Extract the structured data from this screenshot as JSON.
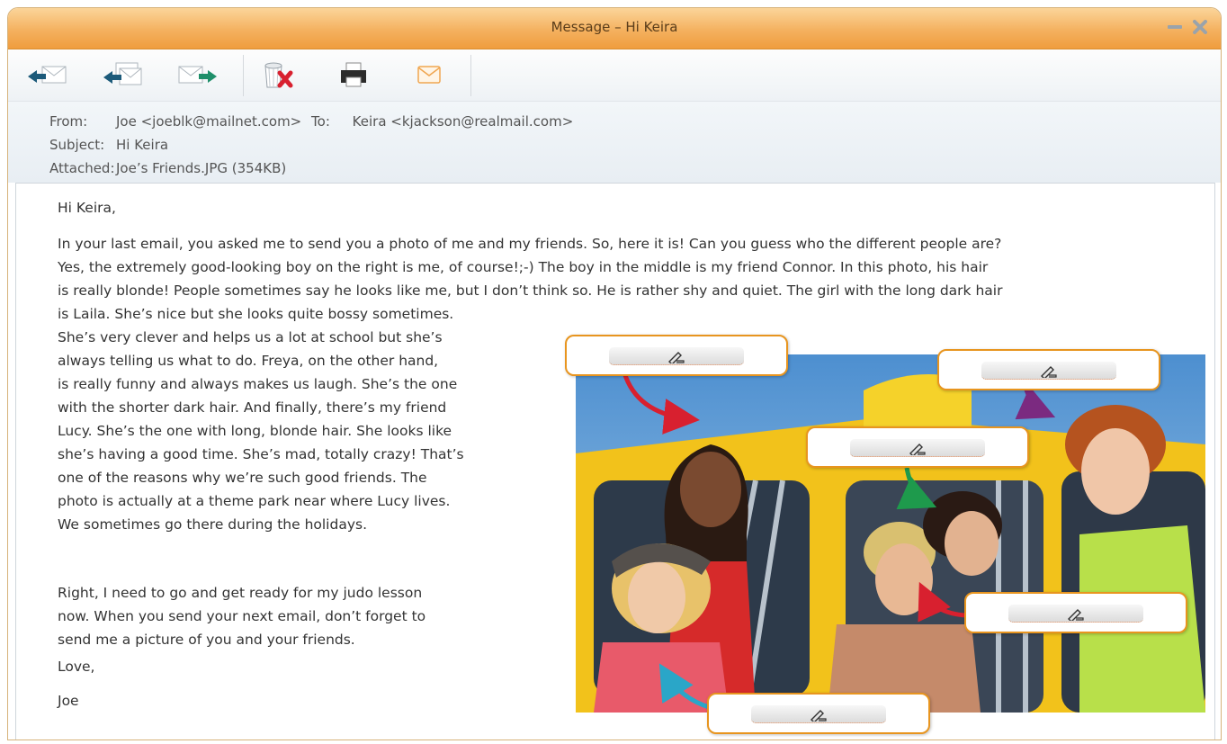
{
  "window": {
    "title": "Message – Hi Keira"
  },
  "toolbar": {
    "icons": [
      "reply-icon",
      "reply-all-icon",
      "forward-icon",
      "delete-icon",
      "print-icon",
      "new-mail-icon"
    ]
  },
  "headers": {
    "from_label": "From:",
    "from_value": "Joe <joeblk@mailnet.com>",
    "to_label": "To:",
    "to_value": "Keira <kjackson@realmail.com>",
    "subject_label": "Subject:",
    "subject_value": "Hi Keira",
    "attached_label": "Attached:",
    "attached_value": "Joe’s Friends.JPG (354KB)"
  },
  "message": {
    "greeting": "Hi Keira,",
    "full_lines": [
      "In your last email, you asked me to send you a photo of me and my friends. So, here it is! Can you guess who the different people are?",
      "Yes, the extremely good-looking boy on the right is me, of course!;-) The boy in the middle is my friend Connor. In this photo, his hair",
      "is really blonde! People sometimes say he looks like me, but I don’t think so. He is rather shy and quiet. The girl with the long dark hair"
    ],
    "wrapped_lines": [
      "is Laila. She’s nice but she looks quite bossy sometimes.",
      "She’s very clever and helps us a lot at school but she’s",
      "always telling us what to do. Freya, on the other hand,",
      "is really funny and always makes us laugh. She’s the one",
      "with the shorter dark hair. And finally, there’s my friend",
      "Lucy. She’s the one with long, blonde hair. She looks like",
      "she’s having a good time. She’s mad, totally crazy! That’s",
      "one of the reasons why we’re such good friends. The",
      "photo is actually at a theme park near where Lucy lives.",
      "We sometimes go there during the holidays."
    ],
    "closing_lines": [
      "Right, I need to go and get ready for my judo lesson",
      "now. When you send your next email, don’t forget to",
      "send me a picture of you and your friends."
    ],
    "signoff": "Love,",
    "signature": "Joe"
  },
  "colors": {
    "title_orange": "#f4b15f",
    "label_border": "#e8951f",
    "arrow_red": "#d8202f",
    "arrow_purple": "#7b2a80",
    "arrow_green": "#1e9a4c",
    "arrow_cyan": "#2aa6c8"
  }
}
